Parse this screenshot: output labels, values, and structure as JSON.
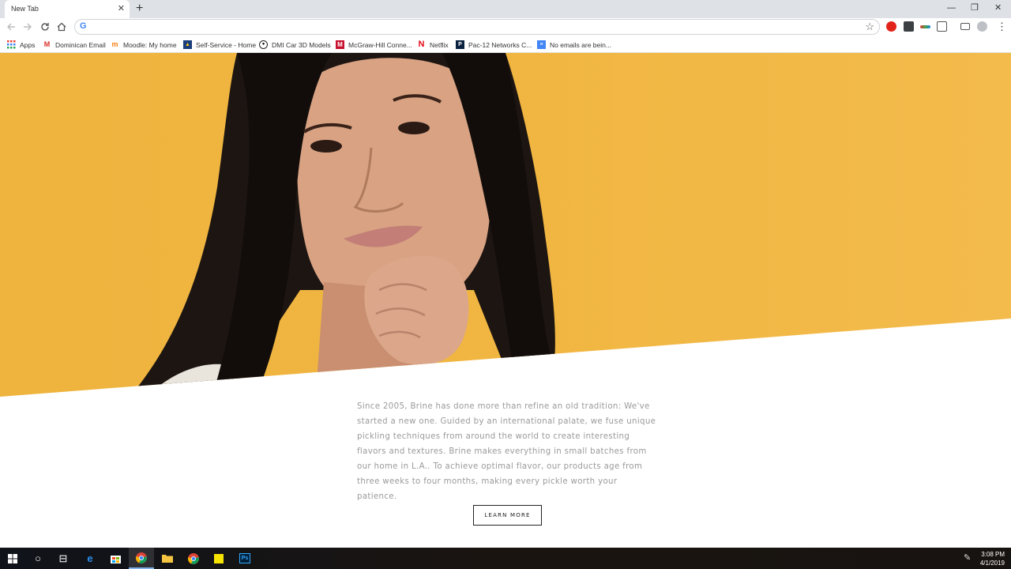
{
  "browser": {
    "tab_title": "New Tab",
    "tab_close": "✕",
    "new_tab": "+",
    "window_controls": [
      "—",
      "❐",
      "✕"
    ],
    "omnibox_value": "",
    "omnibox_logo": "G",
    "bookmarks": [
      {
        "label": "Apps",
        "icon": "apps-grid-icon"
      },
      {
        "label": "Dominican Email",
        "icon": "gmail-icon",
        "color": "#d93025"
      },
      {
        "label": "Moodle: My home",
        "icon": "moodle-icon",
        "color": "#f98012"
      },
      {
        "label": "Self-Service - Home",
        "icon": "self-service-icon",
        "color": "#1a3d7c"
      },
      {
        "label": "DMI Car 3D Models",
        "icon": "dmi-icon",
        "color": "#222222"
      },
      {
        "label": "McGraw-Hill Conne...",
        "icon": "mcgraw-hill-icon",
        "color": "#c8102e"
      },
      {
        "label": "Netflix",
        "icon": "netflix-icon",
        "color": "#e50914"
      },
      {
        "label": "Pac-12 Networks C...",
        "icon": "pac12-icon",
        "color": "#0a2240"
      },
      {
        "label": "No emails are bein...",
        "icon": "docs-icon",
        "color": "#4285f4"
      }
    ]
  },
  "page": {
    "about_text": "Since 2005, Brine has done more than refine an old tradition: We've started a new one. Guided by an international palate, we fuse unique pickling techniques from around the world to create interesting flavors and textures. Brine makes everything in small batches from our home in L.A.. To achieve optimal flavor, our products age from three weeks to four months, making every pickle worth your patience.",
    "learn_more_label": "LEARN MORE",
    "hero_bg": "#f1b641"
  },
  "taskbar": {
    "time": "3:08 PM",
    "date": "4/1/2019"
  }
}
